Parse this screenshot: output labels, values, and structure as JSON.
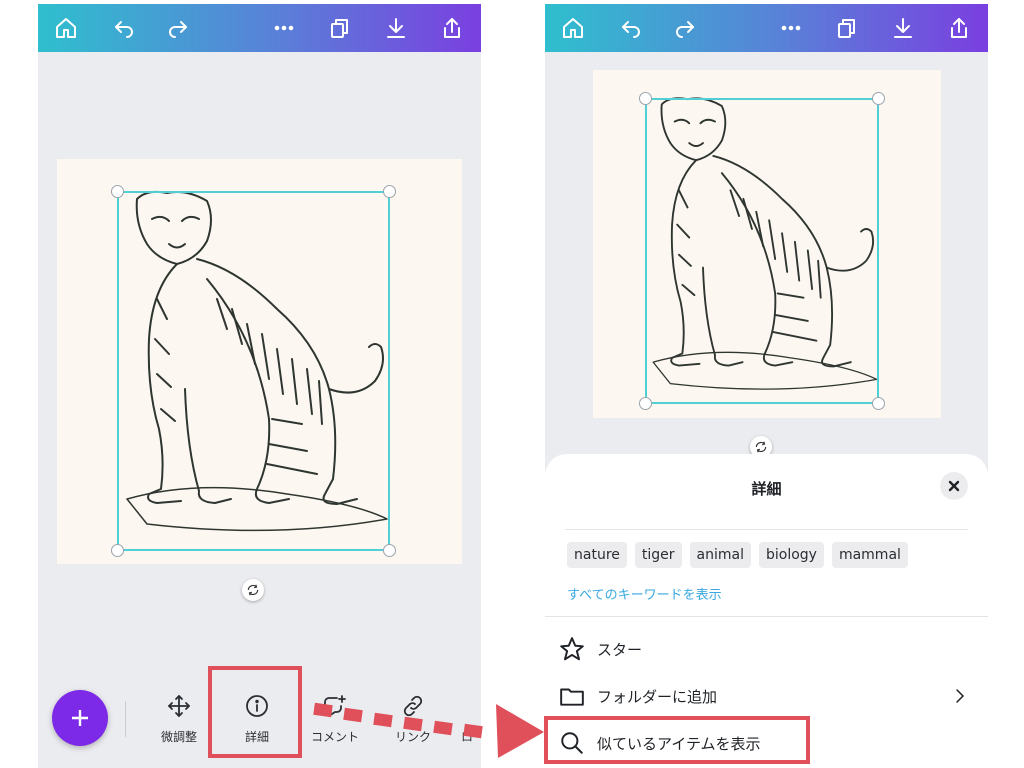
{
  "colors": {
    "topbar_gradient": [
      "#2fbfce",
      "#5a7fd8",
      "#7a3fe0"
    ],
    "accent_purple": "#7d2ae8",
    "selection": "#4fd0d6",
    "highlight_red": "#e0505a",
    "link_blue": "#3aa8e0",
    "canvas_bg": "#fcf8f1"
  },
  "topbar": {
    "icons": [
      "home-icon",
      "undo-icon",
      "redo-icon",
      "more-icon",
      "copy-icon",
      "download-icon",
      "share-icon"
    ]
  },
  "toolbar": {
    "items": [
      {
        "label": "微調整",
        "icon": "move-icon"
      },
      {
        "label": "詳細",
        "icon": "info-icon"
      },
      {
        "label": "コメント",
        "icon": "comment-plus-icon"
      },
      {
        "label": "リンク",
        "icon": "link-icon"
      },
      {
        "label": "ロ",
        "icon": ""
      }
    ]
  },
  "sheet": {
    "title": "詳細",
    "keywords": [
      "nature",
      "tiger",
      "animal",
      "biology",
      "mammal"
    ],
    "show_all_keywords": "すべてのキーワードを表示",
    "menu": [
      {
        "label": "スター",
        "icon": "star-icon"
      },
      {
        "label": "フォルダーに追加",
        "icon": "folder-icon"
      },
      {
        "label": "似ているアイテムを表示",
        "icon": "search-icon"
      }
    ]
  }
}
